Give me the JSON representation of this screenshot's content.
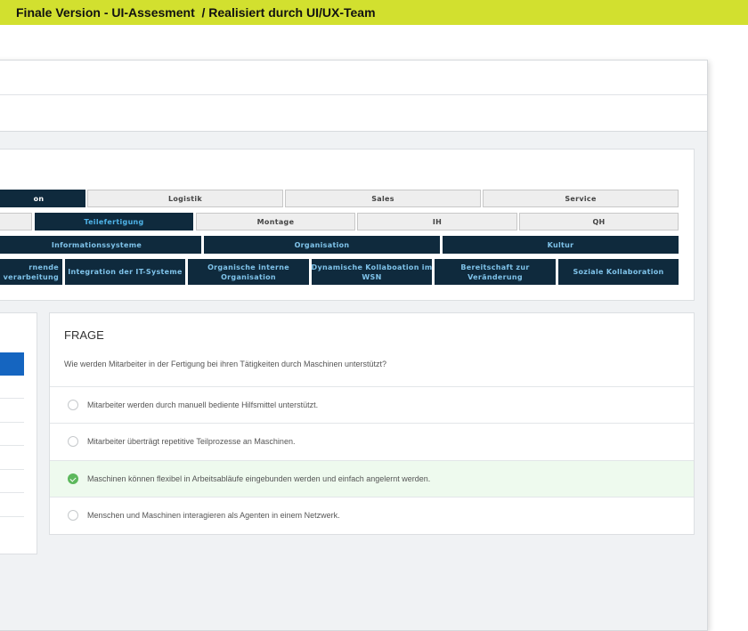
{
  "banner": {
    "text": "Finale Version - UI-Assesment  / Realisiert durch UI/UX-Team"
  },
  "matrix": {
    "row1": [
      "on",
      "Logistik",
      "Sales",
      "Service"
    ],
    "row2": [
      "",
      "Teilefertigung",
      "Montage",
      "IH",
      "QH"
    ],
    "row3": [
      "Informationssysteme",
      "Organisation",
      "Kultur"
    ],
    "row4": [
      "rnende\nverarbeitung",
      "Integration der IT-Systeme",
      "Organische interne\nOrganisation",
      "Dynamische Kollaboation im\nWSN",
      "Bereitschaft zur Veränderung",
      "Soziale Kollaboration"
    ]
  },
  "question": {
    "heading": "FRAGE",
    "text": "Wie werden Mitarbeiter in der Fertigung bei ihren Tätigkeiten durch Maschinen unterstützt?",
    "answers": [
      {
        "label": "Mitarbeiter werden durch manuell bediente Hilfsmittel unterstützt.",
        "selected": false
      },
      {
        "label": "Mitarbeiter überträgt repetitive Teilprozesse an Maschinen.",
        "selected": false
      },
      {
        "label": "Maschinen können flexibel in Arbeitsabläufe eingebunden werden und einfach angelernt werden.",
        "selected": true
      },
      {
        "label": "Menschen und Maschinen interagieren als Agenten in einem Netzwerk.",
        "selected": false
      }
    ]
  },
  "colors": {
    "banner": "#d2e02f",
    "dark_cell": "#0f2a3d",
    "active_text": "#4fb3e8",
    "selected_green": "#5cb85c",
    "blue_button": "#1565c0"
  }
}
